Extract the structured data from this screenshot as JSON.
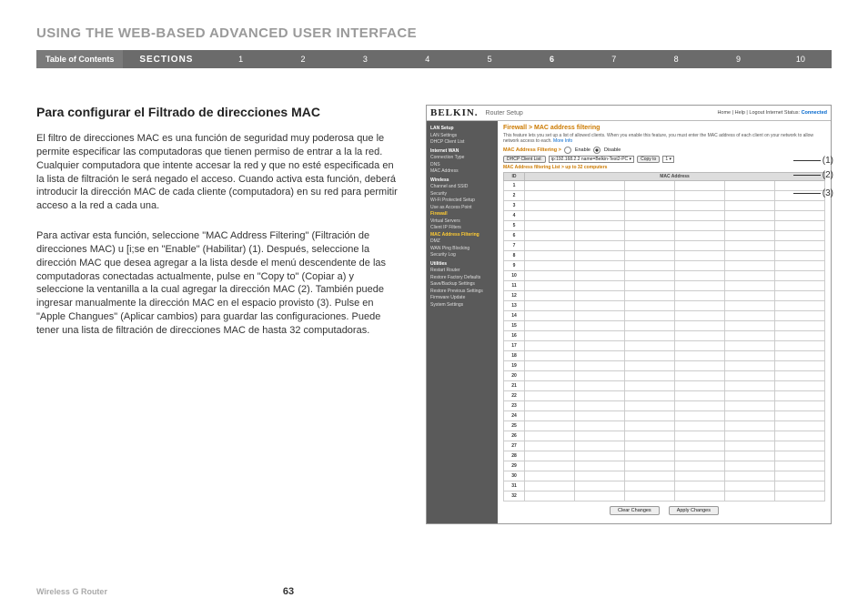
{
  "page_title": "USING THE WEB-BASED ADVANCED USER INTERFACE",
  "nav": {
    "toc": "Table of Contents",
    "sections": "SECTIONS",
    "nums": [
      "1",
      "2",
      "3",
      "4",
      "5",
      "6",
      "7",
      "8",
      "9",
      "10"
    ],
    "active": "6"
  },
  "subheading": "Para configurar el Filtrado de direcciones MAC",
  "para1": "El filtro de direcciones MAC es una función de seguridad muy poderosa que le permite especificar las computadoras que tienen permiso de entrar a la la red. Cualquier computadora que intente accesar la red y que no esté especificada en la lista de filtración le será negado el acceso. Cuando activa esta función, deberá introducir la dirección MAC de cada cliente (computadora) en su red para permitir acceso a la red a cada una.",
  "para2": "Para activar esta función, seleccione \"MAC Address Filtering\" (Filtración de direcciones MAC) u [i;se en \"Enable\" (Habilitar) (1). Después, seleccione la dirección MAC que desea agregar a la lista desde el menú descendente de las computadoras conectadas actualmente, pulse en \"Copy to\" (Copiar a) y seleccione la ventanilla a la cual agregar la dirección MAC (2). También puede ingresar manualmente la dirección MAC en el espacio provisto (3). Pulse en \"Apple Changues\" (Aplicar cambios) para guardar las configuraciones. Puede tener una lista de filtración de direcciones MAC de hasta 32 computadoras.",
  "router": {
    "brand": "BELKIN.",
    "setup": "Router Setup",
    "top_links": "Home | Help | Logout   Internet Status:",
    "connected": "Connected",
    "sidebar": {
      "lan": "LAN Setup",
      "lan1": "LAN Settings",
      "lan2": "DHCP Client List",
      "wan": "Internet WAN",
      "wan1": "Connection Type",
      "wan2": "DNS",
      "wan3": "MAC Address",
      "wireless": "Wireless",
      "w1": "Channel and SSID",
      "w2": "Security",
      "w3": "Wi-Fi Protected Setup",
      "w4": "Use as Access Point",
      "firewall": "Firewall",
      "f1": "Virtual Servers",
      "f2": "Client IP Filters",
      "f3": "MAC Address Filtering",
      "f4": "DMZ",
      "f5": "WAN Ping Blocking",
      "f6": "Security Log",
      "utilities": "Utilities",
      "u1": "Restart Router",
      "u2": "Restore Factory Defaults",
      "u3": "Save/Backup Settings",
      "u4": "Restore Previous Settings",
      "u5": "Firmware Update",
      "u6": "System Settings"
    },
    "main": {
      "title": "Firewall > MAC address filtering",
      "desc": "This feature lets you set up a list of allowed clients. When you enable this feature, you must enter the MAC address of each client on your network to allow network access to each.",
      "more": "More Info",
      "filter_label": "MAC Address Filtering >",
      "enable": "Enable",
      "disable": "Disable",
      "dhcp_btn": "DHCP Client List:",
      "dhcp_sel": "ip:192.168.2.2 name=Belkin-Test2-PC",
      "copy_btn": "Copy to",
      "copy_sel": "1",
      "list_label": "MAC Address filtering List > up to 32 computers",
      "th_id": "ID",
      "th_mac": "MAC Address",
      "rows": [
        1,
        2,
        3,
        4,
        5,
        6,
        7,
        8,
        9,
        10,
        11,
        12,
        13,
        14,
        15,
        16,
        17,
        18,
        19,
        20,
        21,
        22,
        23,
        24,
        25,
        26,
        27,
        28,
        29,
        30,
        31,
        32
      ],
      "clear": "Clear Changes",
      "apply": "Apply Changes"
    }
  },
  "callouts": {
    "c1": "(1)",
    "c2": "(2)",
    "c3": "(3)"
  },
  "footer": {
    "left": "Wireless G Router",
    "page": "63"
  }
}
